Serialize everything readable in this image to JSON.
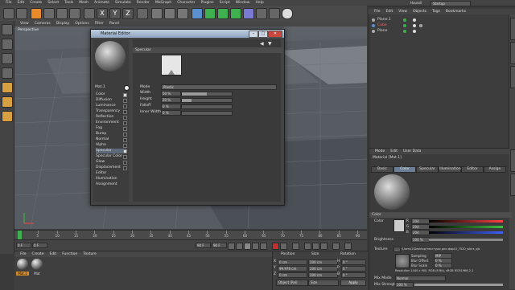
{
  "menubar": {
    "items": [
      "File",
      "Edit",
      "Create",
      "Select",
      "Tools",
      "Mesh",
      "Animate",
      "Simulate",
      "Render",
      "MoGraph",
      "Character",
      "Plugins",
      "Script",
      "Window",
      "Help"
    ],
    "user": "Hauroll",
    "layout": "Startup"
  },
  "object_manager": {
    "menu": [
      "File",
      "Edit",
      "View",
      "Objects",
      "Tags",
      "Bookmarks"
    ],
    "objects": [
      {
        "name": "Plane.1",
        "color": "#cfcfcf"
      },
      {
        "name": "Cube",
        "color": "#ff6060"
      },
      {
        "name": "Plane",
        "color": "#cfcfcf"
      }
    ]
  },
  "viewport": {
    "menu": [
      "View",
      "Cameras",
      "Display",
      "Options",
      "Filter",
      "Panel"
    ],
    "label": "Perspective"
  },
  "material_editor": {
    "title": "Material Editor",
    "material_name": "Mat.1",
    "channels": [
      {
        "label": "Color",
        "checked": true,
        "selected": false
      },
      {
        "label": "Diffusion",
        "checked": false,
        "selected": false
      },
      {
        "label": "Luminance",
        "checked": false,
        "selected": false
      },
      {
        "label": "Transparency",
        "checked": false,
        "selected": false
      },
      {
        "label": "Reflection",
        "checked": false,
        "selected": false
      },
      {
        "label": "Environment",
        "checked": false,
        "selected": false
      },
      {
        "label": "Fog",
        "checked": false,
        "selected": false
      },
      {
        "label": "Bump",
        "checked": false,
        "selected": false
      },
      {
        "label": "Normal",
        "checked": false,
        "selected": false
      },
      {
        "label": "Alpha",
        "checked": false,
        "selected": false
      },
      {
        "label": "Specular",
        "checked": true,
        "selected": true
      },
      {
        "label": "Specular Color",
        "checked": false,
        "selected": false
      },
      {
        "label": "Glow",
        "checked": false,
        "selected": false
      },
      {
        "label": "Displacement",
        "checked": false,
        "selected": false
      },
      {
        "label": "Editor",
        "checked": null,
        "selected": false
      },
      {
        "label": "Illumination",
        "checked": null,
        "selected": false
      },
      {
        "label": "Assignment",
        "checked": null,
        "selected": false
      }
    ],
    "channel_header": "Specular",
    "params": [
      {
        "label": "Mode",
        "value": "Plastic"
      },
      {
        "label": "Width",
        "value": "50 %",
        "level": 0.5
      },
      {
        "label": "Height",
        "value": "20 %",
        "level": 0.2
      },
      {
        "label": "Falloff",
        "value": "0 %",
        "level": 0.0
      },
      {
        "label": "Inner Width",
        "value": "0 %",
        "level": 0.0
      }
    ]
  },
  "timeline": {
    "ticks": [
      "0",
      "5",
      "10",
      "15",
      "20",
      "25",
      "30",
      "35",
      "40",
      "45",
      "50",
      "55",
      "60",
      "65",
      "70",
      "75",
      "80",
      "85",
      "90"
    ],
    "current_frame": "0 F",
    "start_frame": "0 F",
    "end_frame": "90 F",
    "end_frame2": "90 F"
  },
  "material_manager": {
    "menu": [
      "File",
      "Create",
      "Edit",
      "Function",
      "Texture"
    ],
    "materials": [
      "Mat.1",
      "Mat"
    ]
  },
  "coordinates": {
    "headers": [
      "Position",
      "Size",
      "Rotation"
    ],
    "rows": [
      {
        "axis": "X",
        "pos": "0 cm",
        "size": "200 cm",
        "rot_axis": "H",
        "rot": "0 °"
      },
      {
        "axis": "Y",
        "pos": "99.976 cm",
        "size": "200 cm",
        "rot_axis": "P",
        "rot": "0 °"
      },
      {
        "axis": "Z",
        "pos": "0 cm",
        "size": "200 cm",
        "rot_axis": "B",
        "rot": "0 °"
      }
    ],
    "mode1": "Object (Rel)",
    "mode2": "Size",
    "apply": "Apply"
  },
  "attribute_manager": {
    "menu": [
      "Mode",
      "Edit",
      "User Data"
    ],
    "header": "Material [Mat.1]",
    "tabs": [
      {
        "label": "Basic",
        "active": false
      },
      {
        "label": "Color",
        "active": true
      },
      {
        "label": "Specular",
        "active": false
      },
      {
        "label": "Illumination",
        "active": false
      },
      {
        "label": "Editor",
        "active": false
      },
      {
        "label": "Assign",
        "active": false
      }
    ],
    "color_section": "Color",
    "color_label": "Color",
    "r_label": "R",
    "g_label": "G",
    "b_label": "B",
    "r_value": "204",
    "g_value": "204",
    "b_value": "204",
    "brightness_label": "Brightness",
    "brightness_value": "100 %",
    "texture_label": "Texture",
    "texture_value": "...",
    "texture_file": "\\Users\\1\\Desktop\\текстуры дно фыр\\3_7520_sibirs_sjb",
    "sampling_label": "Sampling",
    "sampling_value": "MIP",
    "blur_offset_label": "Blur Offset",
    "blur_offset_value": "0 %",
    "blur_scale_label": "Blur Scale",
    "blur_scale_value": "0 %",
    "resolution_text": "Resolution 1440 x 900, RGB (8 Bit), sRGB IEC61966-2.1",
    "mix_mode_label": "Mix Mode",
    "mix_mode_value": "Normal",
    "mix_strength_label": "Mix Strength",
    "mix_strength_value": "100 %"
  },
  "colors": {
    "accent_red": "#ff4040",
    "accent_green": "#40c040",
    "accent_blue": "#4060ff",
    "selection": "#5d6a7a"
  }
}
